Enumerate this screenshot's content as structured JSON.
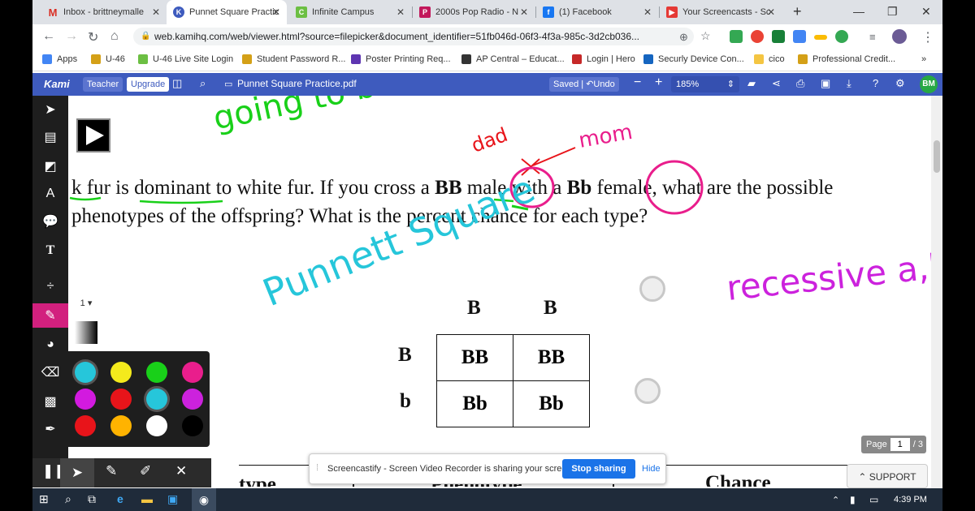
{
  "browser": {
    "tabs": [
      {
        "label": "Inbox - brittneymalle",
        "icon_color": "#d93025"
      },
      {
        "label": "Punnet Square Practic",
        "icon_color": "#3e5bbe",
        "active": true
      },
      {
        "label": "Infinite Campus",
        "icon_color": "#6cbf43"
      },
      {
        "label": "2000s Pop Radio - N",
        "icon_color": "#c2185b"
      },
      {
        "label": "(1) Facebook",
        "icon_color": "#1877f2"
      },
      {
        "label": "Your Screencasts - Sc",
        "icon_color": "#e53935"
      }
    ],
    "url": "web.kamihq.com/web/viewer.html?source=filepicker&document_identifier=51fb046d-06f3-4f3a-985c-3d2cb036...",
    "bookmarks": [
      {
        "label": "Apps",
        "icon_color": "#4285f4"
      },
      {
        "label": "U-46",
        "icon_color": "#d4a017"
      },
      {
        "label": "U-46 Live Site Login",
        "icon_color": "#6cbf43"
      },
      {
        "label": "Student Password R...",
        "icon_color": "#d4a017"
      },
      {
        "label": "Poster Printing Req...",
        "icon_color": "#5e35b1"
      },
      {
        "label": "AP Central – Educat...",
        "icon_color": "#333333"
      },
      {
        "label": "Login | Hero",
        "icon_color": "#c62828"
      },
      {
        "label": "Securly Device Con...",
        "icon_color": "#1565c0"
      },
      {
        "label": "cico",
        "icon_color": "#f4c542"
      },
      {
        "label": "Professional Credit...",
        "icon_color": "#d4a017"
      }
    ],
    "more_bookmarks": "»"
  },
  "kami": {
    "brand": "Kami",
    "role_badge": "Teacher",
    "upgrade_label": "Upgrade",
    "filename": "Punnet Square Practice.pdf",
    "saved_label": "Saved",
    "undo_label": "Undo",
    "zoom": "185%",
    "avatar_initials": "BM",
    "accent_color": "#3e5bbe"
  },
  "document": {
    "question_line1_a": "k fur is dominant to white fur. If you cross a ",
    "question_bb": "BB",
    "question_line1_b": " male with a ",
    "question_bbsmall": "Bb",
    "question_line1_c": " female, what are the possible",
    "question_line2": "phenotypes of the offspring? What is the percent chance for each type?",
    "punnett": {
      "col_headers": [
        "B",
        "B"
      ],
      "row_headers": [
        "B",
        "b"
      ],
      "cells": [
        [
          "BB",
          "BB"
        ],
        [
          "Bb",
          "Bb"
        ]
      ]
    },
    "table_headers": [
      "type",
      "Phenotype",
      "Chance"
    ]
  },
  "annotations": {
    "green_text": "going to be expressed",
    "red_dad": "dad",
    "red_mom": "mom",
    "cyan_text": "Punnett Square",
    "magenta_text": "recessive a,b can be hid"
  },
  "pen": {
    "size": "1",
    "colors": [
      "#26c6da",
      "#f4ea1c",
      "#19d019",
      "#e91e8c",
      "#d21adf",
      "#e8141a",
      "#26c6da",
      "#cc22dd",
      "#e8141a",
      "#ffb300",
      "#ffffff",
      "#000000"
    ]
  },
  "screencastify": {
    "message": "Screencastify - Screen Video Recorder is sharing your screen.",
    "stop_label": "Stop sharing",
    "hide_label": "Hide"
  },
  "pager": {
    "label": "Page",
    "current": "1",
    "total": "/ 3"
  },
  "support_label": "SUPPORT",
  "taskbar": {
    "time": "4:39 PM"
  }
}
